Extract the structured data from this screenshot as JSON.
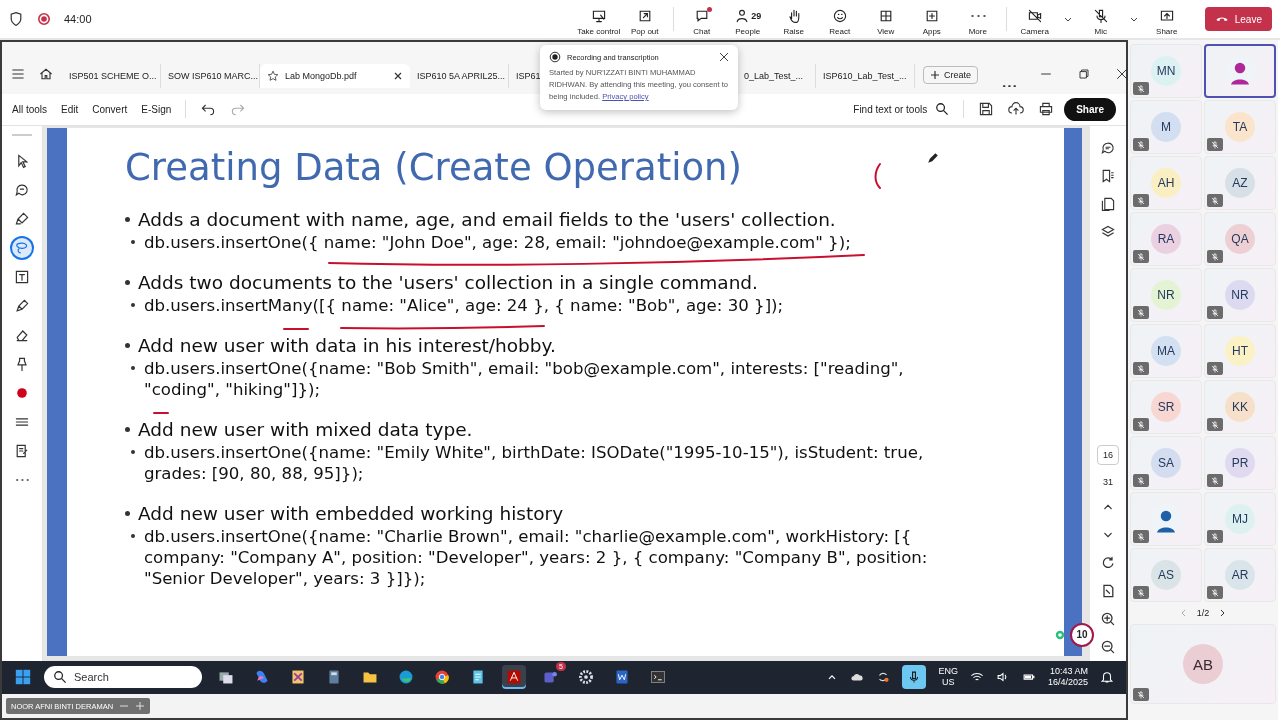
{
  "meeting": {
    "timer": "44:00"
  },
  "meeting_controls": [
    {
      "label": "Take control",
      "unread": false,
      "menu": false
    },
    {
      "label": "Pop out",
      "unread": false,
      "menu": false
    },
    {
      "label": "Chat",
      "unread": true,
      "menu": false
    },
    {
      "label": "People",
      "count": "29",
      "unread": false,
      "menu": false
    },
    {
      "label": "Raise",
      "unread": false,
      "menu": false
    },
    {
      "label": "React",
      "unread": false,
      "menu": false
    },
    {
      "label": "View",
      "unread": false,
      "menu": false
    },
    {
      "label": "Apps",
      "unread": false,
      "menu": false
    },
    {
      "label": "More",
      "unread": false,
      "menu": false
    },
    {
      "label": "Camera",
      "unread": false,
      "menu": true
    },
    {
      "label": "Mic",
      "unread": false,
      "menu": true
    },
    {
      "label": "Share",
      "unread": false,
      "menu": false
    }
  ],
  "leave_button": "Leave",
  "notification": {
    "title": "Recording and transcription",
    "message": "Started by NUR'IZZATI BINTI MUHAMMAD RIDHWAN. By attending this meeting, you consent to being included.",
    "link": "Privacy policy"
  },
  "pdf_tabs": [
    {
      "label": "ISP501 SCHEME O...",
      "selected": false
    },
    {
      "label": "SOW ISP610 MARC...",
      "selected": false
    },
    {
      "label": "Lab MongoDb.pdf",
      "selected": true
    },
    {
      "label": "ISP610 5A APRIL25...",
      "selected": false
    },
    {
      "label": "ISP61",
      "selected": false
    },
    {
      "label": "0_Lab_Test_...",
      "selected": false
    },
    {
      "label": "ISP610_Lab_Test_...",
      "selected": false
    }
  ],
  "create_button": "Create",
  "menus": [
    "All tools",
    "Edit",
    "Convert",
    "E-Sign"
  ],
  "find": "Find text or tools",
  "share_button": "Share",
  "tools": [
    {
      "selected": false
    },
    {
      "selected": false
    },
    {
      "selected": false
    },
    {
      "selected": true
    },
    {
      "selected": false
    },
    {
      "selected": false
    },
    {
      "selected": false
    },
    {
      "selected": false
    },
    {
      "selected": false
    },
    {
      "selected": false
    },
    {
      "selected": false
    },
    {
      "selected": false
    }
  ],
  "slide": {
    "title": "Creating Data (Create Operation)",
    "bullets": [
      {
        "text": "Adds a document with name, age, and email fields to the 'users' collection.",
        "sub": [
          "db.users.insertOne({ name: \"John Doe\", age: 28, email: \"johndoe@example.com\" });"
        ]
      },
      {
        "text": "Adds two documents to the 'users' collection in a single command.",
        "sub": [
          "db.users.insertMany([{ name: \"Alice\", age: 24 }, { name: \"Bob\", age: 30 }]);"
        ]
      },
      {
        "text": "Add new user with data in his interest/hobby.",
        "sub": [
          "db.users.insertOne({name: \"Bob Smith\", email: \"bob@example.com\", interests: [\"reading\", \"coding\", \"hiking\"]});"
        ]
      },
      {
        "text": "Add new user with mixed data type.",
        "sub": [
          "db.users.insertOne({name: \"Emily White\", birthDate: ISODate(\"1995-10-15\"), isStudent: true, grades: [90, 80, 88, 95]});"
        ]
      },
      {
        "text": "Add new user with embedded working history",
        "sub": [
          "db.users.insertOne({name: \"Charlie Brown\", email: \"charlie@example.com\", workHistory: [{ company: \"Company A\", position: \"Developer\", years: 2 }, { company: \"Company B\", position: \"Senior Developer\", years: 3 }]});"
        ]
      }
    ]
  },
  "page_nav": {
    "current": "16",
    "total": "31"
  },
  "count_badge": "10",
  "taskbar": {
    "search_placeholder": "Search",
    "apps": [
      {
        "active": false
      },
      {
        "active": false
      },
      {
        "active": false
      },
      {
        "active": false
      },
      {
        "active": false
      },
      {
        "active": false
      },
      {
        "active": false
      },
      {
        "active": false
      },
      {
        "active": true
      },
      {
        "active": false,
        "badge": "5"
      },
      {
        "active": false
      },
      {
        "active": false
      },
      {
        "active": false
      }
    ],
    "lang": "ENG",
    "region": "US",
    "time": "10:43 AM",
    "date": "16/4/2025"
  },
  "presenter": "NOOR AFNI BINTI DERAMAN",
  "participants": [
    {
      "kind": "initials",
      "initials": "MN",
      "color": "#dcf2f2",
      "muted": true,
      "speaking": false
    },
    {
      "kind": "photo",
      "color": "#b0279a",
      "muted": false,
      "speaking": true
    },
    {
      "kind": "initials",
      "initials": "M",
      "color": "#d3def0",
      "muted": true,
      "speaking": false
    },
    {
      "kind": "initials",
      "initials": "TA",
      "color": "#fbe4cc",
      "muted": true,
      "speaking": false
    },
    {
      "kind": "initials",
      "initials": "AH",
      "color": "#faefc2",
      "muted": true,
      "speaking": false
    },
    {
      "kind": "initials",
      "initials": "AZ",
      "color": "#d6e0e6",
      "muted": true,
      "speaking": false
    },
    {
      "kind": "initials",
      "initials": "RA",
      "color": "#ebd0e2",
      "muted": true,
      "speaking": false
    },
    {
      "kind": "initials",
      "initials": "QA",
      "color": "#eed0d4",
      "muted": true,
      "speaking": false
    },
    {
      "kind": "initials",
      "initials": "NR",
      "color": "#e4f3d4",
      "muted": true,
      "speaking": false
    },
    {
      "kind": "initials",
      "initials": "NR",
      "color": "#dbdaf0",
      "muted": true,
      "speaking": false
    },
    {
      "kind": "initials",
      "initials": "MA",
      "color": "#d2e0f2",
      "muted": true,
      "speaking": false
    },
    {
      "kind": "initials",
      "initials": "HT",
      "color": "#faf2c4",
      "muted": true,
      "speaking": false
    },
    {
      "kind": "initials",
      "initials": "SR",
      "color": "#f8d7d2",
      "muted": true,
      "speaking": false
    },
    {
      "kind": "initials",
      "initials": "KK",
      "color": "#f7e0ca",
      "muted": true,
      "speaking": false
    },
    {
      "kind": "initials",
      "initials": "SA",
      "color": "#d3ddef",
      "muted": true,
      "speaking": false
    },
    {
      "kind": "initials",
      "initials": "PR",
      "color": "#e0daf0",
      "muted": true,
      "speaking": false
    },
    {
      "kind": "photo",
      "color": "#1f5fa8",
      "muted": true,
      "speaking": false
    },
    {
      "kind": "initials",
      "initials": "MJ",
      "color": "#ddf1f1",
      "muted": true,
      "speaking": false
    },
    {
      "kind": "initials",
      "initials": "AS",
      "color": "#dae3e6",
      "muted": true,
      "speaking": false
    },
    {
      "kind": "initials",
      "initials": "AR",
      "color": "#d9e5ea",
      "muted": true,
      "speaking": false
    }
  ],
  "pager": "1/2",
  "featured": {
    "initials": "AB",
    "color": "#ebcdd4",
    "muted": true
  }
}
